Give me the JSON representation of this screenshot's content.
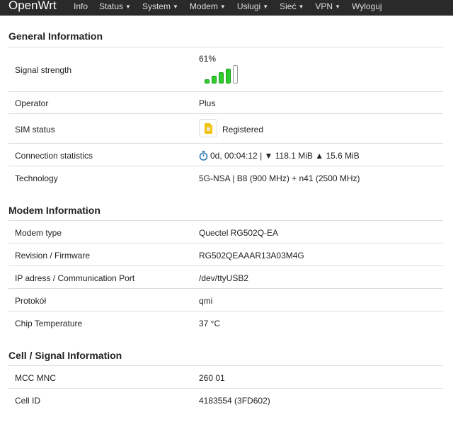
{
  "nav": {
    "brand": "OpenWrt",
    "items": [
      {
        "label": "Info",
        "caret": false
      },
      {
        "label": "Status",
        "caret": true
      },
      {
        "label": "System",
        "caret": true
      },
      {
        "label": "Modem",
        "caret": true
      },
      {
        "label": "Usługi",
        "caret": true
      },
      {
        "label": "Sieć",
        "caret": true
      },
      {
        "label": "VPN",
        "caret": true
      },
      {
        "label": "Wyloguj",
        "caret": false
      }
    ]
  },
  "general": {
    "title": "General Information",
    "signal_label": "Signal strength",
    "signal_value": "61%",
    "signal_bars_filled": 4,
    "signal_bars_total": 5,
    "operator_label": "Operator",
    "operator_value": "Plus",
    "sim_label": "SIM status",
    "sim_value": "Registered",
    "conn_label": "Connection statistics",
    "conn_uptime": "0d, 00:04:12",
    "conn_rx": "▼ 118.1 MiB",
    "conn_tx": "▲ 15.6 MiB",
    "tech_label": "Technology",
    "tech_value": "5G-NSA | B8 (900 MHz) + n41 (2500 MHz)"
  },
  "modem": {
    "title": "Modem Information",
    "type_label": "Modem type",
    "type_value": "Quectel RG502Q-EA",
    "fw_label": "Revision / Firmware",
    "fw_value": "RG502QEAAAR13A03M4G",
    "port_label": "IP adress / Communication Port",
    "port_value": "/dev/ttyUSB2",
    "proto_label": "Protokół",
    "proto_value": "qmi",
    "temp_label": "Chip Temperature",
    "temp_value": "37 °C"
  },
  "cell": {
    "title": "Cell / Signal Information",
    "mcc_label": "MCC MNC",
    "mcc_value": "260 01",
    "cellid_label": "Cell ID",
    "cellid_value": "4183554 (3FD602)"
  },
  "colors": {
    "navbar": "#2a2a2a",
    "signal_bar": "#2ecc2e",
    "sim_card": "#f1c40f",
    "timer_icon": "#2a7ab8"
  }
}
